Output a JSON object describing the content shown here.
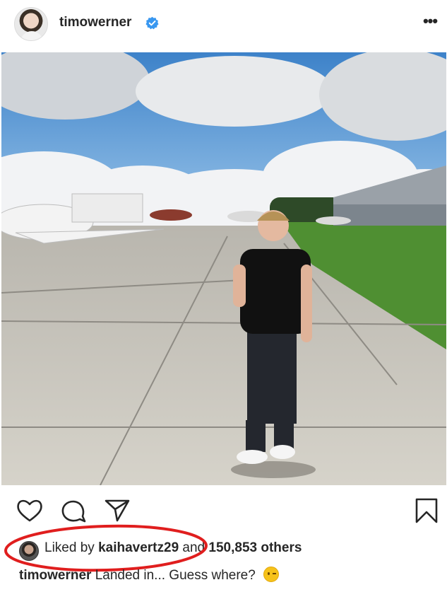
{
  "header": {
    "username": "timowerner",
    "more_glyph": "•••",
    "icons": {
      "avatar": "profile-photo",
      "verified": "verified-badge-icon",
      "more": "more-options-icon"
    }
  },
  "post": {
    "image_description": "",
    "actions": {
      "icons": [
        "heart-icon",
        "comment-icon",
        "share-icon",
        "bookmark-icon"
      ]
    },
    "likes": {
      "prefix": "Liked by",
      "liker": "kaihavertz29",
      "middle": "and",
      "count": "150,853 others",
      "highlight_color": "#e01e1e"
    },
    "caption": {
      "user": "timowerner",
      "text": "Landed in... Guess where?",
      "emoji": "winking-face-emoji"
    }
  },
  "colors": {
    "text": "#262626",
    "verified_blue": "#3897f0",
    "annotation_red": "#e01e1e"
  }
}
